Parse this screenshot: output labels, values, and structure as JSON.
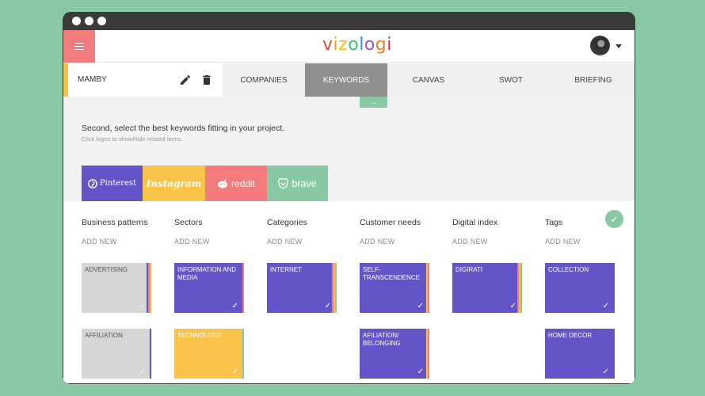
{
  "app": {
    "logo": "vizologi",
    "logo_colors": [
      "#e74c3c",
      "#f39c12",
      "#f1c40f",
      "#2ecc71",
      "#3498db",
      "#9b59b6",
      "#e67e22",
      "#e91e63"
    ]
  },
  "project": {
    "name": "MAMBY"
  },
  "tabs": [
    "COMPANIES",
    "KEYWORDS",
    "CANVAS",
    "SWOT",
    "BRIEFING"
  ],
  "active_tab": "KEYWORDS",
  "arrow_tab": "→",
  "instruction": "Second, select the best keywords fitting in your project.",
  "hint": "Click logos to show/hide related items.",
  "sources": [
    {
      "label": "Pinterest",
      "color": "#6355c7"
    },
    {
      "label": "Instagram",
      "color": "#f9c449"
    },
    {
      "label": "reddit",
      "color": "#f47b7b"
    },
    {
      "label": "brave",
      "color": "#88c8a3"
    }
  ],
  "columns": [
    {
      "title": "Business patterns",
      "add": "ADD NEW"
    },
    {
      "title": "Sectors",
      "add": "ADD NEW"
    },
    {
      "title": "Categories",
      "add": "ADD NEW"
    },
    {
      "title": "Customer needs",
      "add": "ADD NEW"
    },
    {
      "title": "Digital index",
      "add": "ADD NEW"
    },
    {
      "title": "Tags",
      "add": "ADD NEW"
    }
  ],
  "cards": {
    "advertising": "ADVERTISING",
    "affiliation": "AFFILIATION",
    "information_media": "INFORMATION AND MEDIA",
    "technology": "TECHNOLOGY",
    "internet": "INTERNET",
    "self_transcendence": "SELF-TRANSCENDENCE",
    "affiliation_belonging": "AFILIATION/ BELONGING",
    "digirati": "DIGIRATI",
    "collection": "COLLECTION",
    "home_decor": "HOME DECOR"
  },
  "check_glyph": "✓",
  "colors": {
    "accent_green": "#88c8a3",
    "menu_red": "#f47b7b",
    "purple": "#6355c7",
    "yellow": "#f9c449",
    "gray_card": "#d6d6d6"
  }
}
